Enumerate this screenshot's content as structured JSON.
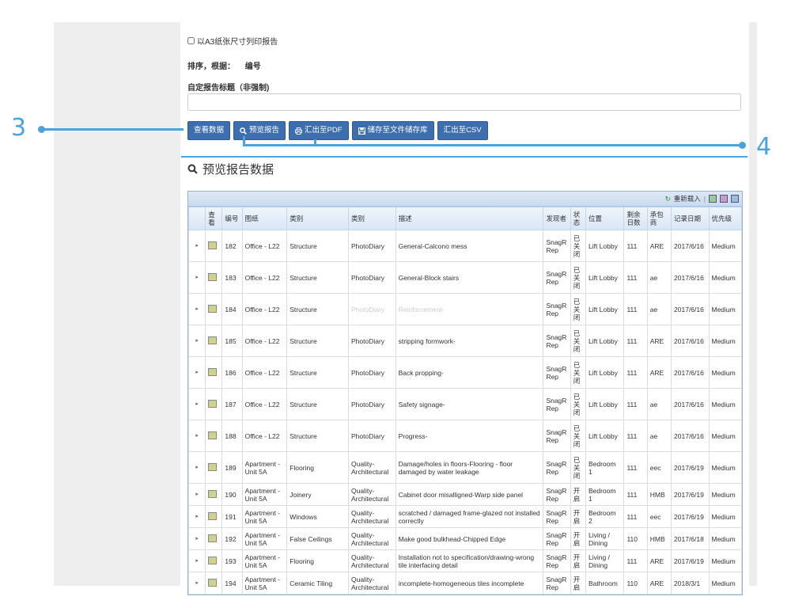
{
  "options": {
    "a3_label": "以A3纸张尺寸列印报告",
    "sort_label": "排序，根据：",
    "sort_value": "编号",
    "title_label": "自定报告标题（非强制)",
    "title_value": ""
  },
  "buttons": {
    "view": "查看数据",
    "preview": "预览报告",
    "pdf": "汇出至PDF",
    "save": "储存至文件储存库",
    "csv": "汇出至CSV"
  },
  "callouts": {
    "left": "3",
    "right": "4"
  },
  "preview": {
    "title": "预览报告数据",
    "reload": "重新载入",
    "separator": "|"
  },
  "table": {
    "headers": [
      "",
      "查看",
      "编号",
      "图纸",
      "类别",
      "类别",
      "描述",
      "发现者",
      "状态",
      "位置",
      "剩余日数",
      "承包商",
      "记录日期",
      "优先级"
    ],
    "rows": [
      {
        "id": "182",
        "drawing": "Office - L22",
        "cat1": "Structure",
        "cat2": "PhotoDiary",
        "desc": "General-Calcono mess",
        "finder": "SnagR Rep",
        "status": "已关闭",
        "loc": "Lift Lobby",
        "days": "111",
        "contractor": "ARE",
        "date": "2017/6/16",
        "priority": "Medium"
      },
      {
        "id": "183",
        "drawing": "Office - L22",
        "cat1": "Structure",
        "cat2": "PhotoDiary",
        "desc": "General-Block stairs",
        "finder": "SnagR Rep",
        "status": "已关闭",
        "loc": "Lift Lobby",
        "days": "111",
        "contractor": "ae",
        "date": "2017/6/16",
        "priority": "Medium"
      },
      {
        "id": "184",
        "drawing": "Office - L22",
        "cat1": "Structure",
        "cat2": "PhotoDiary",
        "desc": "Reinforcement-",
        "finder": "SnagR Rep",
        "status": "已关闭",
        "loc": "Lift Lobby",
        "days": "111",
        "contractor": "ae",
        "date": "2017/6/16",
        "priority": "Medium"
      },
      {
        "id": "185",
        "drawing": "Office - L22",
        "cat1": "Structure",
        "cat2": "PhotoDiary",
        "desc": "stripping formwork-",
        "finder": "SnagR Rep",
        "status": "已关闭",
        "loc": "Lift Lobby",
        "days": "111",
        "contractor": "ARE",
        "date": "2017/6/16",
        "priority": "Medium"
      },
      {
        "id": "186",
        "drawing": "Office - L22",
        "cat1": "Structure",
        "cat2": "PhotoDiary",
        "desc": "Back propping-",
        "finder": "SnagR Rep",
        "status": "已关闭",
        "loc": "Lift Lobby",
        "days": "111",
        "contractor": "ARE",
        "date": "2017/6/16",
        "priority": "Medium"
      },
      {
        "id": "187",
        "drawing": "Office - L22",
        "cat1": "Structure",
        "cat2": "PhotoDiary",
        "desc": "Safety signage-",
        "finder": "SnagR Rep",
        "status": "已关闭",
        "loc": "Lift Lobby",
        "days": "111",
        "contractor": "ae",
        "date": "2017/6/16",
        "priority": "Medium"
      },
      {
        "id": "188",
        "drawing": "Office - L22",
        "cat1": "Structure",
        "cat2": "PhotoDiary",
        "desc": "Progress-",
        "finder": "SnagR Rep",
        "status": "已关闭",
        "loc": "Lift Lobby",
        "days": "111",
        "contractor": "ae",
        "date": "2017/6/16",
        "priority": "Medium"
      },
      {
        "id": "189",
        "drawing": "Apartment - Unit 5A",
        "cat1": "Flooring",
        "cat2": "Quality-Architectural",
        "desc": "Damage/holes in floors-Flooring - floor damaged by water leakage",
        "finder": "SnagR Rep",
        "status": "已关闭",
        "loc": "Bedroom 1",
        "days": "111",
        "contractor": "eec",
        "date": "2017/6/19",
        "priority": "Medium"
      },
      {
        "id": "190",
        "drawing": "Apartment - Unit 5A",
        "cat1": "Joinery",
        "cat2": "Quality-Architectural",
        "desc": "Cabinet door misalligned-Warp side panel",
        "finder": "SnagR Rep",
        "status": "开启",
        "loc": "Bedroom 1",
        "days": "111",
        "contractor": "HMB",
        "date": "2017/6/19",
        "priority": "Medium"
      },
      {
        "id": "191",
        "drawing": "Apartment - Unit 5A",
        "cat1": "Windows",
        "cat2": "Quality-Architectural",
        "desc": "scratched / damaged frame-glazed not installed correctly",
        "finder": "SnagR Rep",
        "status": "开启",
        "loc": "Bedroom 2",
        "days": "111",
        "contractor": "eec",
        "date": "2017/6/19",
        "priority": "Medium"
      },
      {
        "id": "192",
        "drawing": "Apartment - Unit 5A",
        "cat1": "False Ceilings",
        "cat2": "Quality-Architectural",
        "desc": "Make good bulkhead-Chipped Edge",
        "finder": "SnagR Rep",
        "status": "开启",
        "loc": "Living / Dining",
        "days": "110",
        "contractor": "HMB",
        "date": "2017/6/18",
        "priority": "Medium"
      },
      {
        "id": "193",
        "drawing": "Apartment - Unit 5A",
        "cat1": "Flooring",
        "cat2": "Quality-Architectural",
        "desc": "Installation not to specification/drawing-wrong tile interfacing detail",
        "finder": "SnagR Rep",
        "status": "开启",
        "loc": "Living / Dining",
        "days": "111",
        "contractor": "ARE",
        "date": "2017/6/19",
        "priority": "Medium"
      },
      {
        "id": "194",
        "drawing": "Apartment - Unit 5A",
        "cat1": "Ceramic Tiling",
        "cat2": "Quality-Architectural",
        "desc": "incomplete-homogeneous tiles incomplete",
        "finder": "SnagR Rep",
        "status": "开启",
        "loc": "Bathroom",
        "days": "110",
        "contractor": "ARE",
        "date": "2018/3/1",
        "priority": "Medium"
      }
    ]
  },
  "colors": {
    "button": "#3d6fb0",
    "callout": "#4aa3df",
    "grid_header": "#d9e6f5"
  }
}
